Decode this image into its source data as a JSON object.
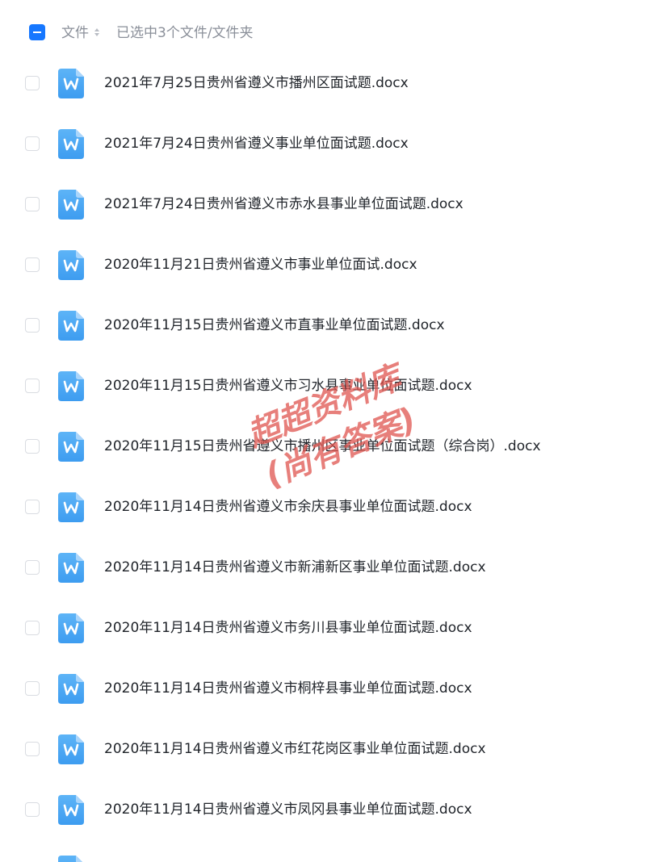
{
  "header": {
    "column_label": "文件",
    "selected_info": "已选中3个文件/文件夹"
  },
  "files": [
    {
      "name": "2021年7月25日贵州省遵义市播州区面试题.docx",
      "icon": "word-doc-icon"
    },
    {
      "name": "2021年7月24日贵州省遵义事业单位面试题.docx",
      "icon": "word-doc-icon"
    },
    {
      "name": "2021年7月24日贵州省遵义市赤水县事业单位面试题.docx",
      "icon": "word-doc-icon"
    },
    {
      "name": "2020年11月21日贵州省遵义市事业单位面试.docx",
      "icon": "word-doc-icon"
    },
    {
      "name": "2020年11月15日贵州省遵义市直事业单位面试题.docx",
      "icon": "word-doc-icon"
    },
    {
      "name": "2020年11月15日贵州省遵义市习水县事业单位面试题.docx",
      "icon": "word-doc-icon"
    },
    {
      "name": "2020年11月15日贵州省遵义市播州区事业单位面试题（综合岗）.docx",
      "icon": "word-doc-icon"
    },
    {
      "name": "2020年11月14日贵州省遵义市余庆县事业单位面试题.docx",
      "icon": "word-doc-icon"
    },
    {
      "name": "2020年11月14日贵州省遵义市新浦新区事业单位面试题.docx",
      "icon": "word-doc-icon"
    },
    {
      "name": "2020年11月14日贵州省遵义市务川县事业单位面试题.docx",
      "icon": "word-doc-icon"
    },
    {
      "name": "2020年11月14日贵州省遵义市桐梓县事业单位面试题.docx",
      "icon": "word-doc-icon"
    },
    {
      "name": "2020年11月14日贵州省遵义市红花岗区事业单位面试题.docx",
      "icon": "word-doc-icon"
    },
    {
      "name": "2020年11月14日贵州省遵义市凤冈县事业单位面试题.docx",
      "icon": "word-doc-icon"
    },
    {
      "name": "",
      "icon": "word-doc-icon"
    }
  ],
  "watermark": {
    "line1": "超超资料库",
    "line2": "(尚有答案)"
  },
  "colors": {
    "accent": "#1677ff",
    "icon_blue": "#4aa8f5",
    "watermark_red": "#e0554f"
  }
}
